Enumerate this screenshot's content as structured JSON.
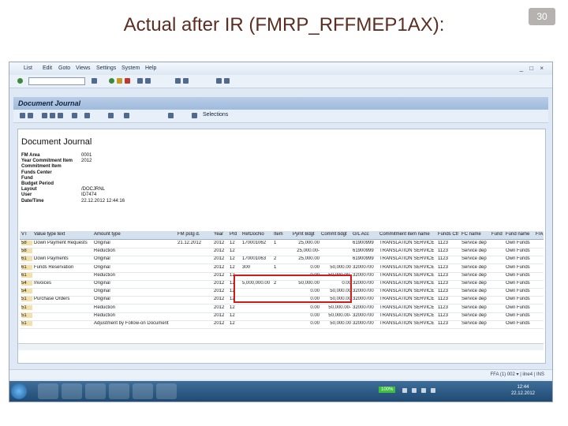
{
  "slide": {
    "title": "Actual after IR (FMRP_RFFMEP1AX):",
    "page_number": "30"
  },
  "menu": [
    "List",
    "Edit",
    "Goto",
    "Views",
    "Settings",
    "System",
    "Help"
  ],
  "window_controls": "_ □ ×",
  "title_bar": "Document Journal",
  "toolbar": {
    "selections_label": "Selections"
  },
  "report": {
    "title": "Document Journal",
    "header": [
      {
        "label": "FM Area",
        "value": "0001"
      },
      {
        "label": "Year Commitment Item",
        "value": "2012"
      },
      {
        "label": "Commitment Item",
        "value": ""
      },
      {
        "label": "Funds Center",
        "value": ""
      },
      {
        "label": "Fund",
        "value": ""
      },
      {
        "label": "Budget Period",
        "value": ""
      },
      {
        "label": "Layout",
        "value": "/DOCJRNL"
      },
      {
        "label": "User",
        "value": "ID7474"
      },
      {
        "label": "Date/Time",
        "value": "22.12.2012 12:44:16"
      }
    ]
  },
  "table": {
    "columns": [
      "VT",
      "Value type text",
      "Amount type",
      "FM pstg d.",
      "Year",
      "Prd",
      "RefDocNo",
      "Item",
      "Pymt Bdgt",
      "Commt bdgt",
      "G/L Acc",
      "Commitment item name",
      "Funds Ctr",
      "FC name",
      "Fund",
      "Fund name",
      "F/A"
    ],
    "rows": [
      [
        "58",
        "Down Payment Requests",
        "Original",
        "21.12.2012",
        "2012",
        "12",
        "170001062",
        "1",
        "25,000.00",
        "",
        "61900999",
        "TRANSLATION SERVICE",
        "1123",
        "Service dep",
        "",
        "Own Funds",
        ""
      ],
      [
        "58",
        "",
        "Reduction",
        "",
        "2012",
        "12",
        "",
        "",
        "25,000.00-",
        "",
        "61900999",
        "TRANSLATION SERVICE",
        "1123",
        "Service dep",
        "",
        "Own Funds",
        ""
      ],
      [
        "61",
        "Down Payments",
        "Original",
        "",
        "2012",
        "12",
        "170001063",
        "2",
        "25,000.00",
        "",
        "61900999",
        "TRANSLATION SERVICE",
        "1123",
        "Service dep",
        "",
        "Own Funds",
        ""
      ],
      [
        "61",
        "Funds Reservation",
        "Original",
        "",
        "2012",
        "12",
        "300",
        "1",
        "0.00",
        "50,000.00",
        "32000700",
        "TRANSLATION SERVICE",
        "1123",
        "Service dep",
        "",
        "Own Funds",
        ""
      ],
      [
        "61",
        "",
        "Reduction",
        "",
        "2012",
        "12",
        "",
        "",
        "0.00",
        "50,000.00-",
        "32000700",
        "TRANSLATION SERVICE",
        "1123",
        "Service dep",
        "",
        "Own Funds",
        ""
      ],
      [
        "54",
        "Invoices",
        "Original",
        "",
        "2012",
        "12",
        "5,000,000.00",
        "2",
        "50,000.00",
        "0.00",
        "32000700",
        "TRANSLATION SERVICE",
        "1123",
        "Service dep",
        "",
        "Own Funds",
        ""
      ],
      [
        "54",
        "",
        "Original",
        "",
        "2012",
        "12",
        "",
        "",
        "0.00",
        "50,000.00",
        "32000700",
        "TRANSLATION SERVICE",
        "1123",
        "Service dep",
        "",
        "Own Funds",
        ""
      ],
      [
        "51",
        "Purchase Orders",
        "Original",
        "",
        "2012",
        "12",
        "",
        "",
        "0.00",
        "50,000.00",
        "32000700",
        "TRANSLATION SERVICE",
        "1123",
        "Service dep",
        "",
        "Own Funds",
        ""
      ],
      [
        "51",
        "",
        "Reduction",
        "",
        "2012",
        "12",
        "",
        "",
        "0.00",
        "50,000.00-",
        "32000700",
        "TRANSLATION SERVICE",
        "1123",
        "Service dep",
        "",
        "Own Funds",
        ""
      ],
      [
        "51",
        "",
        "Reduction",
        "",
        "2012",
        "12",
        "",
        "",
        "0.00",
        "50,000.00-",
        "32000700",
        "TRANSLATION SERVICE",
        "1123",
        "Service dep",
        "",
        "Own Funds",
        ""
      ],
      [
        "51",
        "",
        "Adjustment by Follow-on Document",
        "",
        "2012",
        "12",
        "",
        "",
        "0.00",
        "50,000.00",
        "32000700",
        "TRANSLATION SERVICE",
        "1123",
        "Service dep",
        "",
        "Own Funds",
        ""
      ]
    ]
  },
  "status_bar": "FFA (1) 002 ▾ | ilne4 | INS",
  "taskbar": {
    "battery": "100%",
    "time": "12:44",
    "date": "22.12.2012"
  }
}
